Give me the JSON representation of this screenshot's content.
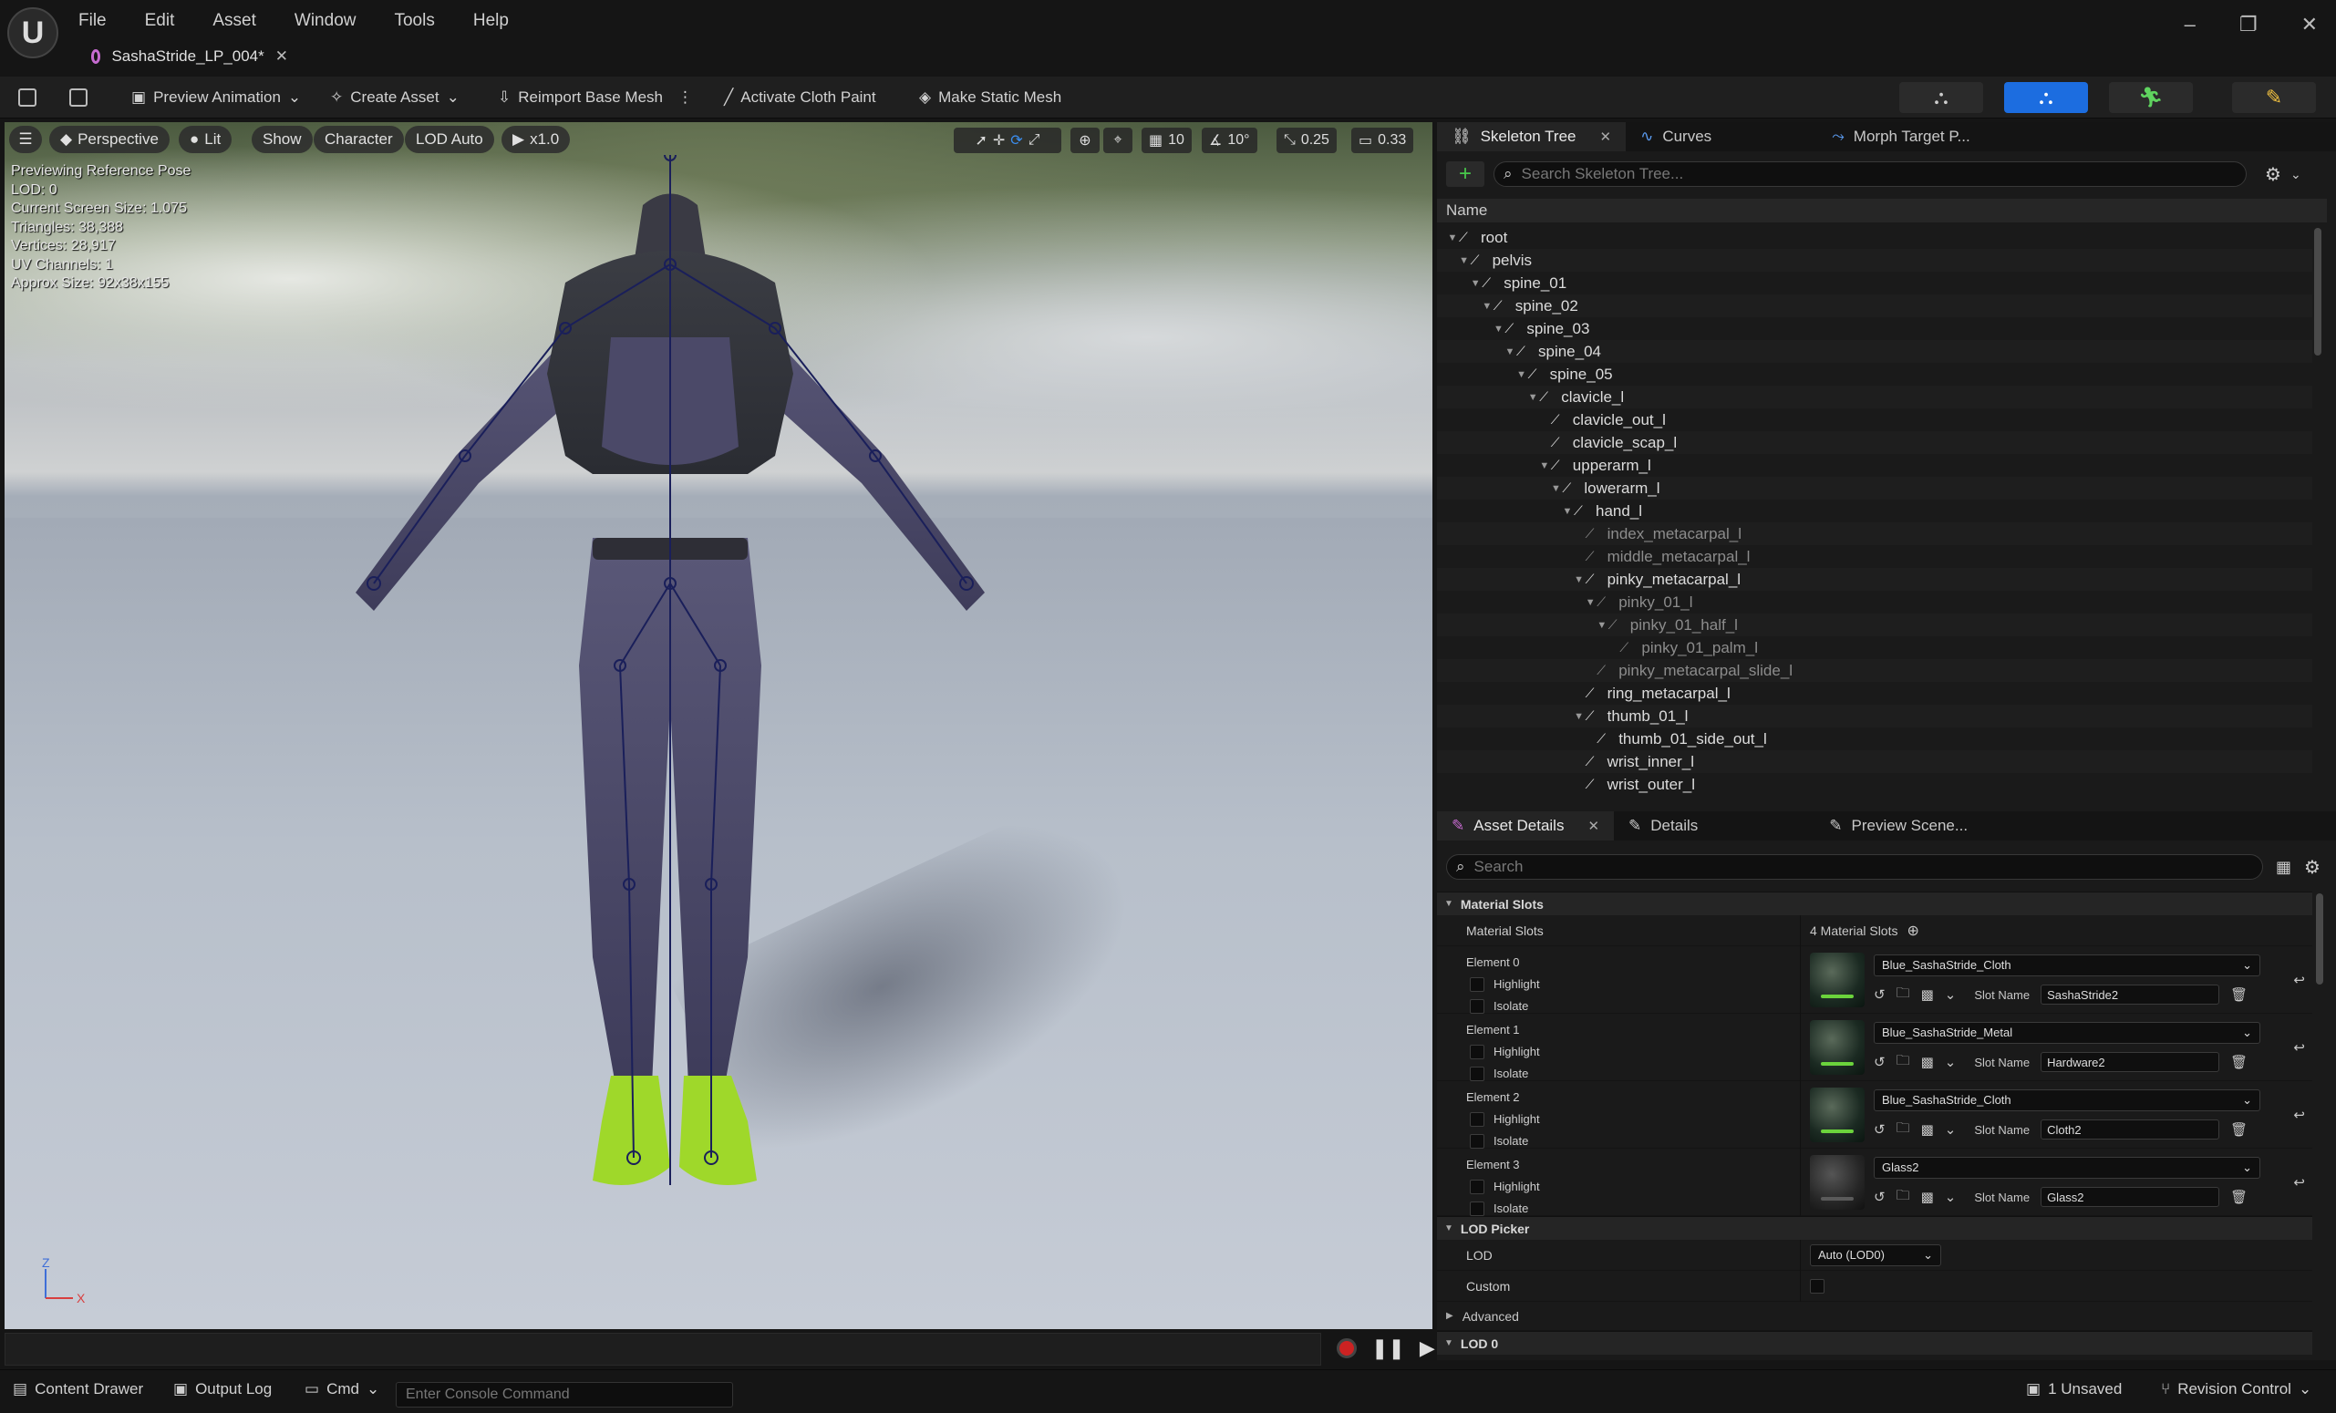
{
  "app": {
    "menu": [
      "File",
      "Edit",
      "Asset",
      "Window",
      "Tools",
      "Help"
    ],
    "asset_tab": "SashaStride_LP_004*"
  },
  "toolbar": {
    "preview_animation": "Preview Animation",
    "create_asset": "Create Asset",
    "reimport": "Reimport Base Mesh",
    "cloth_paint": "Activate Cloth Paint",
    "static_mesh": "Make Static Mesh"
  },
  "viewport": {
    "perspective": "Perspective",
    "lit": "Lit",
    "show": "Show",
    "character": "Character",
    "lod": "LOD Auto",
    "speed": "x1.0",
    "grid_snap": "10",
    "rot_snap": "10°",
    "scale_snap": "0.25",
    "cam_speed": "0.33",
    "stats": [
      "Previewing Reference Pose",
      "LOD: 0",
      "Current Screen Size: 1.075",
      "Triangles: 38,388",
      "Vertices: 28,917",
      "UV Channels: 1",
      "Approx Size: 92x38x155"
    ],
    "axis_z": "Z",
    "axis_x": "X"
  },
  "skeleton": {
    "tabs": [
      "Skeleton Tree",
      "Curves",
      "Morph Target P..."
    ],
    "search_placeholder": "Search Skeleton Tree...",
    "column": "Name",
    "bones": [
      {
        "name": "root",
        "depth": 0,
        "expanded": true,
        "dim": false
      },
      {
        "name": "pelvis",
        "depth": 1,
        "expanded": true,
        "dim": false
      },
      {
        "name": "spine_01",
        "depth": 2,
        "expanded": true,
        "dim": false
      },
      {
        "name": "spine_02",
        "depth": 3,
        "expanded": true,
        "dim": false
      },
      {
        "name": "spine_03",
        "depth": 4,
        "expanded": true,
        "dim": false
      },
      {
        "name": "spine_04",
        "depth": 5,
        "expanded": true,
        "dim": false
      },
      {
        "name": "spine_05",
        "depth": 6,
        "expanded": true,
        "dim": false
      },
      {
        "name": "clavicle_l",
        "depth": 7,
        "expanded": true,
        "dim": false
      },
      {
        "name": "clavicle_out_l",
        "depth": 8,
        "expanded": false,
        "dim": false
      },
      {
        "name": "clavicle_scap_l",
        "depth": 8,
        "expanded": false,
        "dim": false
      },
      {
        "name": "upperarm_l",
        "depth": 8,
        "expanded": true,
        "dim": false
      },
      {
        "name": "lowerarm_l",
        "depth": 9,
        "expanded": true,
        "dim": false
      },
      {
        "name": "hand_l",
        "depth": 10,
        "expanded": true,
        "dim": false
      },
      {
        "name": "index_metacarpal_l",
        "depth": 11,
        "expanded": false,
        "dim": true
      },
      {
        "name": "middle_metacarpal_l",
        "depth": 11,
        "expanded": false,
        "dim": true
      },
      {
        "name": "pinky_metacarpal_l",
        "depth": 11,
        "expanded": true,
        "dim": false
      },
      {
        "name": "pinky_01_l",
        "depth": 12,
        "expanded": true,
        "dim": true
      },
      {
        "name": "pinky_01_half_l",
        "depth": 13,
        "expanded": true,
        "dim": true
      },
      {
        "name": "pinky_01_palm_l",
        "depth": 14,
        "expanded": false,
        "dim": true
      },
      {
        "name": "pinky_metacarpal_slide_l",
        "depth": 12,
        "expanded": false,
        "dim": true
      },
      {
        "name": "ring_metacarpal_l",
        "depth": 11,
        "expanded": false,
        "dim": false
      },
      {
        "name": "thumb_01_l",
        "depth": 11,
        "expanded": true,
        "dim": false
      },
      {
        "name": "thumb_01_side_out_l",
        "depth": 12,
        "expanded": false,
        "dim": false
      },
      {
        "name": "wrist_inner_l",
        "depth": 11,
        "expanded": false,
        "dim": false
      },
      {
        "name": "wrist_outer_l",
        "depth": 11,
        "expanded": false,
        "dim": false
      }
    ]
  },
  "details": {
    "tabs": [
      "Asset Details",
      "Details",
      "Preview Scene..."
    ],
    "search_placeholder": "Search",
    "material_section": "Material Slots",
    "material_slots_label": "Material Slots",
    "material_slots_count": "4 Material Slots",
    "highlight": "Highlight",
    "isolate": "Isolate",
    "slot_name_label": "Slot Name",
    "elements": [
      {
        "label": "Element 0",
        "material": "Blue_SashaStride_Cloth",
        "slot": "SashaStride2",
        "glass": false
      },
      {
        "label": "Element 1",
        "material": "Blue_SashaStride_Metal",
        "slot": "Hardware2",
        "glass": false
      },
      {
        "label": "Element 2",
        "material": "Blue_SashaStride_Cloth",
        "slot": "Cloth2",
        "glass": false
      },
      {
        "label": "Element 3",
        "material": "Glass2",
        "slot": "Glass2",
        "glass": true
      }
    ],
    "lod_picker_section": "LOD Picker",
    "lod_label": "LOD",
    "lod_value": "Auto (LOD0)",
    "custom_label": "Custom",
    "advanced": "Advanced",
    "lod0_section": "LOD 0"
  },
  "status": {
    "content_drawer": "Content Drawer",
    "output_log": "Output Log",
    "cmd": "Cmd",
    "console_placeholder": "Enter Console Command",
    "unsaved": "1 Unsaved",
    "revision": "Revision Control"
  }
}
